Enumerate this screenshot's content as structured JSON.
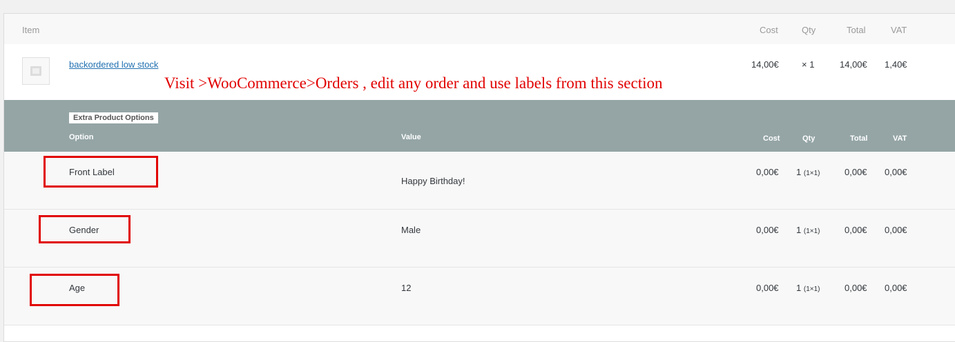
{
  "header": {
    "item": "Item",
    "cost": "Cost",
    "qty": "Qty",
    "total": "Total",
    "vat": "VAT"
  },
  "item": {
    "name": "backordered low stock",
    "cost": "14,00€",
    "qty": "× 1",
    "total": "14,00€",
    "vat": "1,40€",
    "thumbnail_icon": "image-placeholder-icon"
  },
  "annotation": "Visit >WooCommerce>Orders , edit any order and use labels from this section",
  "epo": {
    "title": "Extra Product Options",
    "columns": {
      "option": "Option",
      "value": "Value",
      "cost": "Cost",
      "qty": "Qty",
      "total": "Total",
      "vat": "VAT"
    },
    "rows": [
      {
        "option": "Front Label",
        "value": "Happy Birthday!",
        "cost": "0,00€",
        "qty": "1",
        "qty_detail": "(1×1)",
        "total": "0,00€",
        "vat": "0,00€"
      },
      {
        "option": "Gender",
        "value": "Male",
        "cost": "0,00€",
        "qty": "1",
        "qty_detail": "(1×1)",
        "total": "0,00€",
        "vat": "0,00€"
      },
      {
        "option": "Age",
        "value": "12",
        "cost": "0,00€",
        "qty": "1",
        "qty_detail": "(1×1)",
        "total": "0,00€",
        "vat": "0,00€"
      }
    ]
  },
  "colors": {
    "annotation_red": "#e10000",
    "epo_header_bg": "#95a5a6",
    "link_blue": "#2271b1"
  }
}
